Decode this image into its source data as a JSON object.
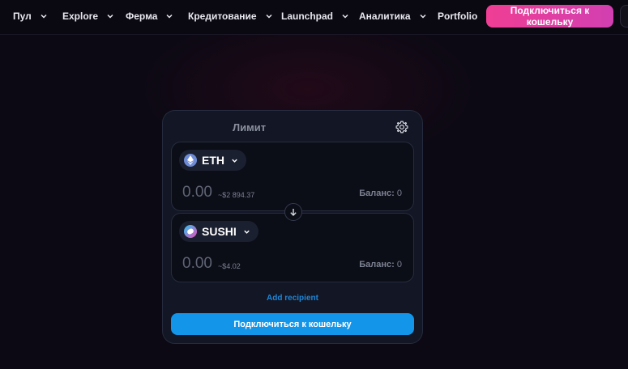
{
  "nav": {
    "items": [
      {
        "label": "Пул",
        "icon": "chevron-down-icon"
      },
      {
        "label": "Explore",
        "icon": "chevron-down-icon"
      },
      {
        "label": "Ферма",
        "icon": "chevron-down-icon"
      },
      {
        "label": "Кредитование",
        "icon": "chevron-down-icon"
      },
      {
        "label": "Launchpad",
        "icon": "chevron-down-icon"
      },
      {
        "label": "Аналитика",
        "icon": "chevron-down-icon"
      },
      {
        "label": "Portfolio"
      }
    ],
    "connect_label": "Подключиться к кошельку"
  },
  "widget": {
    "tab_label": "Лимит",
    "settings_icon": "gear-icon",
    "swap_icon": "arrow-down-icon",
    "from": {
      "symbol": "ETH",
      "icon": "eth-token-icon",
      "amount_placeholder": "0.00",
      "usd_value": "~$2 894.37",
      "balance_label": "Баланс:",
      "balance_value": "0"
    },
    "to": {
      "symbol": "SUSHI",
      "icon": "sushi-token-icon",
      "amount_placeholder": "0.00",
      "usd_value": "~$4.02",
      "balance_label": "Баланс:",
      "balance_value": "0"
    },
    "add_recipient": "Add recipient",
    "connect_label": "Подключиться к кошельку"
  },
  "colors": {
    "background": "#0c0914",
    "accent_pink": "#ef3e94",
    "accent_blue": "#1396ea",
    "panel": "#121625"
  }
}
